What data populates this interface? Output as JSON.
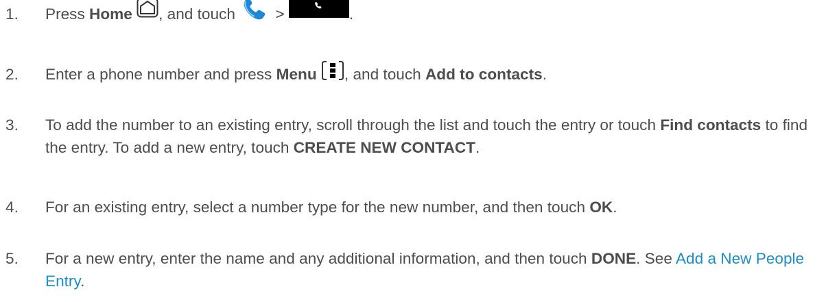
{
  "steps": [
    {
      "number": "1.",
      "parts": {
        "t1": "Press ",
        "b1": "Home",
        "t2": ", and touch ",
        "t3": " > ",
        "t4": "."
      },
      "icons": [
        "home-button-icon",
        "phone-icon",
        "dial-call-button-icon"
      ]
    },
    {
      "number": "2.",
      "parts": {
        "t1": "Enter a phone number and press ",
        "b1": "Menu",
        "t2": ", and touch ",
        "b2": "Add to contacts",
        "t3": "."
      },
      "icons": [
        "menu-button-icon"
      ]
    },
    {
      "number": "3.",
      "parts": {
        "t1": "To add the number to an existing entry, scroll through the list and touch the entry or touch ",
        "b1": "Find contacts",
        "t2": " to find the entry. To add a new entry, touch ",
        "b2": "CREATE NEW CONTACT",
        "t3": "."
      }
    },
    {
      "number": "4.",
      "parts": {
        "t1": "For an existing entry, select a number type for the new number, and then touch ",
        "b1": "OK",
        "t2": "."
      }
    },
    {
      "number": "5.",
      "parts": {
        "t1": "For a new entry, enter the name and any additional information, and then touch ",
        "b1": "DONE",
        "t2": ". See ",
        "link": "Add a New People Entry",
        "t3": "."
      }
    }
  ],
  "colors": {
    "text": "#4d4d4d",
    "link": "#1a8fc9",
    "phone_icon": "#1e88d8",
    "dial_button": "#000000"
  }
}
